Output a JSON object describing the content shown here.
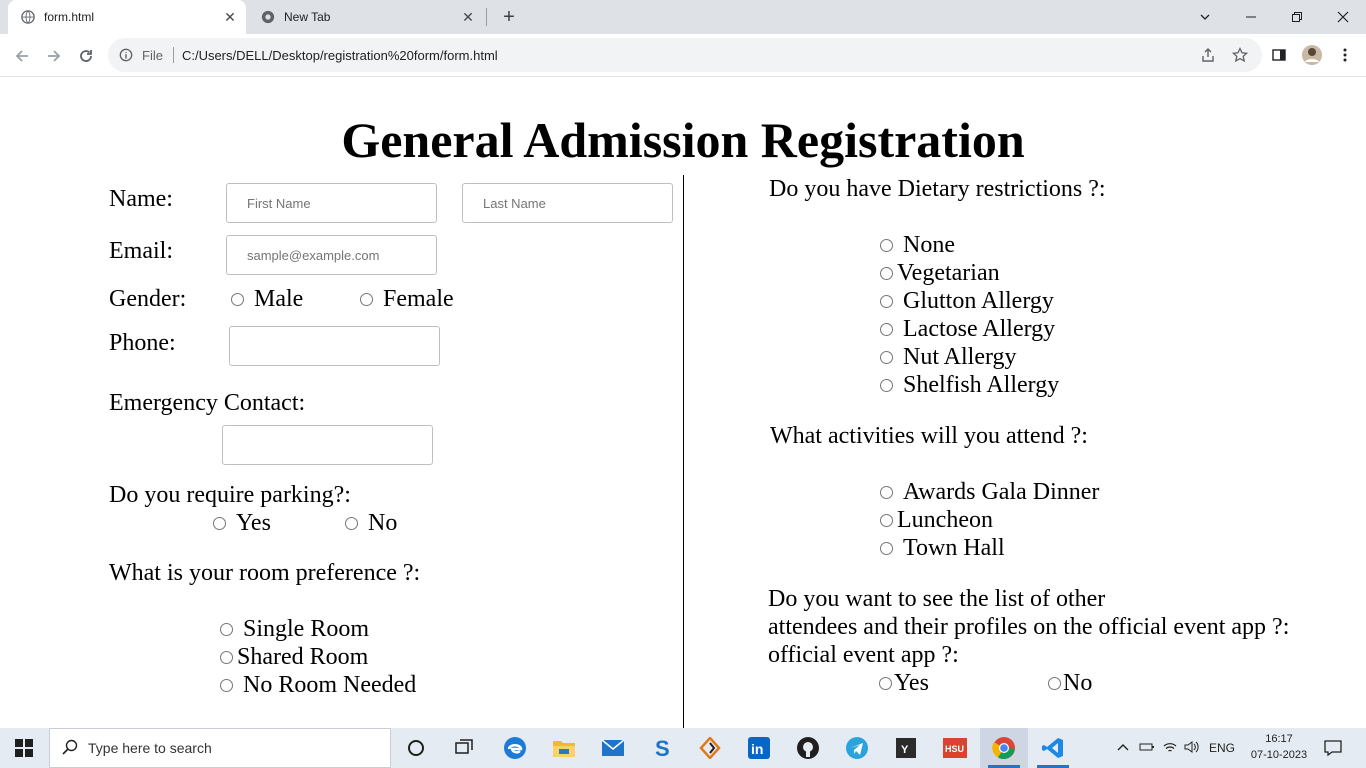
{
  "browser": {
    "tabs": [
      {
        "title": "form.html",
        "active": true
      },
      {
        "title": "New Tab",
        "active": false
      }
    ],
    "omnibox": {
      "scheme_label": "File",
      "url": "C:/Users/DELL/Desktop/registration%20form/form.html"
    }
  },
  "form": {
    "heading": "General Admission Registration",
    "name": {
      "label": "Name:",
      "first_placeholder": "First Name",
      "last_placeholder": "Last Name"
    },
    "email": {
      "label": "Email:",
      "placeholder": "sample@example.com"
    },
    "gender": {
      "label": "Gender:",
      "options": [
        "Male",
        "Female"
      ]
    },
    "phone": {
      "label": "Phone:"
    },
    "emergency": {
      "label": "Emergency Contact:"
    },
    "parking": {
      "question": "Do you require parking?:",
      "options": [
        "Yes",
        "No"
      ]
    },
    "room": {
      "question": "What is your room preference ?:",
      "options": [
        "Single Room",
        "Shared Room",
        "No Room Needed"
      ]
    },
    "dietary": {
      "question": "Do you have Dietary restrictions ?:",
      "options": [
        "None",
        "Vegetarian",
        "Glutton Allergy",
        "Lactose Allergy",
        "Nut Allergy",
        "Shelfish Allergy"
      ]
    },
    "activities": {
      "question": "What activities will you attend ?:",
      "options": [
        "Awards Gala Dinner",
        "Luncheon",
        "Town Hall"
      ]
    },
    "attendees": {
      "question_lines": [
        "Do you want to see the list of other",
        "attendees and their profiles on the official event app ?:",
        "official event app ?:"
      ],
      "options": [
        "Yes",
        "No"
      ]
    }
  },
  "taskbar": {
    "search_placeholder": "Type here to search",
    "language": "ENG",
    "time": "16:17",
    "date": "07-10-2023"
  }
}
